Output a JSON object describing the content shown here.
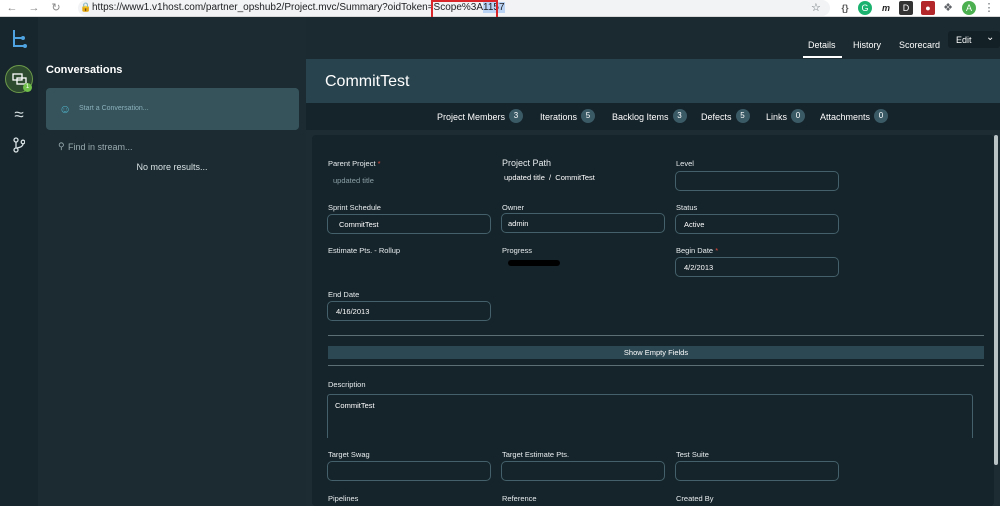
{
  "browser": {
    "url_prefix": "https://www1.v1host.com/partner_opshub2/Project.mvc/Summary?oidToken=Scope%3A",
    "url_highlight": "1157",
    "profile_initial": "A"
  },
  "rail": {
    "badge": "1"
  },
  "conversations": {
    "title": "Conversations",
    "input_placeholder": "Start a Conversation...",
    "stream_placeholder": "Find in stream...",
    "no_more": "No more results..."
  },
  "tabs": {
    "details": "Details",
    "history": "History",
    "scorecard": "Scorecard",
    "edit": "Edit"
  },
  "project": {
    "title": "CommitTest"
  },
  "relations": [
    {
      "label": "Project Members",
      "count": "3"
    },
    {
      "label": "Iterations",
      "count": "5"
    },
    {
      "label": "Backlog Items",
      "count": "3"
    },
    {
      "label": "Defects",
      "count": "5"
    },
    {
      "label": "Links",
      "count": "0"
    },
    {
      "label": "Attachments",
      "count": "0"
    }
  ],
  "fields": {
    "parent_project": {
      "label": "Parent Project",
      "req": "*",
      "value": "updated title"
    },
    "project_path": {
      "label": "Project Path",
      "value": "updated title  /  CommitTest"
    },
    "level": {
      "label": "Level",
      "value": ""
    },
    "sprint_schedule": {
      "label": "Sprint Schedule",
      "value": "CommitTest"
    },
    "owner": {
      "label": "Owner",
      "value": "admin"
    },
    "status": {
      "label": "Status",
      "value": "Active"
    },
    "estimate": {
      "label": "Estimate Pts. - Rollup"
    },
    "progress": {
      "label": "Progress"
    },
    "begin_date": {
      "label": "Begin Date",
      "req": "*",
      "value": "4/2/2013"
    },
    "end_date": {
      "label": "End Date",
      "value": "4/16/2013"
    },
    "show_empty": "Show Empty Fields",
    "description": {
      "label": "Description",
      "value": "CommitTest"
    },
    "target_swag": {
      "label": "Target Swag"
    },
    "target_estimate": {
      "label": "Target Estimate Pts."
    },
    "test_suite": {
      "label": "Test Suite"
    },
    "pipelines": {
      "label": "Pipelines"
    },
    "reference": {
      "label": "Reference"
    },
    "created_by": {
      "label": "Created By"
    }
  }
}
